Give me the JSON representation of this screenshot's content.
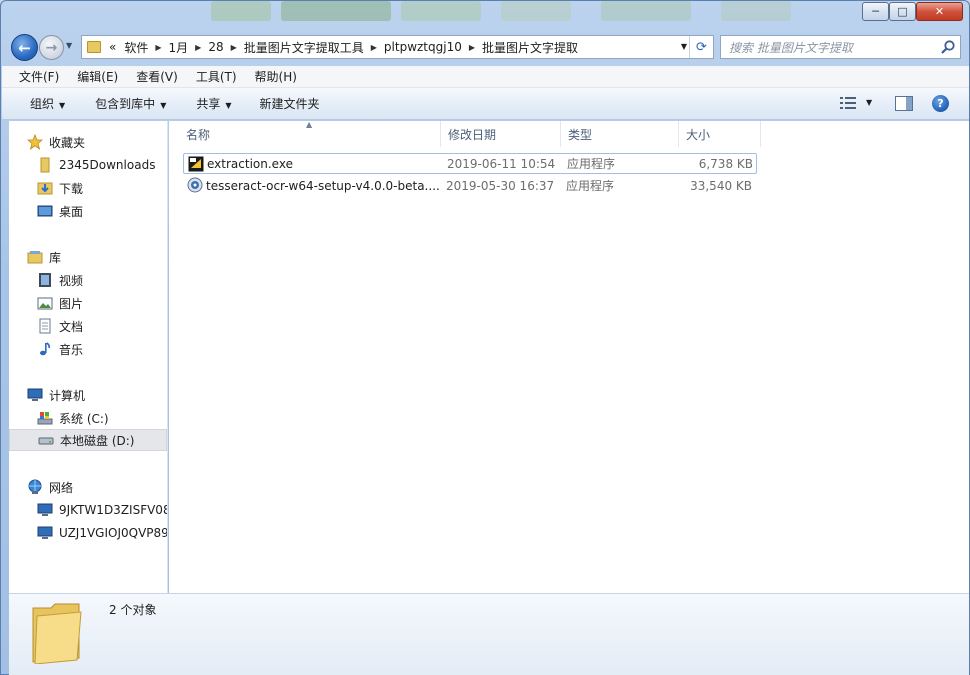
{
  "window": {
    "controls": {
      "minimize": "─",
      "maximize": "□",
      "close": "✕"
    }
  },
  "nav": {
    "back_glyph": "←",
    "forward_glyph": "→",
    "overflow": "«",
    "breadcrumbs": [
      "软件",
      "1月",
      "28",
      "批量图片文字提取工具",
      "pltpwztqgj10",
      "批量图片文字提取"
    ],
    "refresh_glyph": "⟳",
    "search_placeholder": "搜索 批量图片文字提取"
  },
  "menubar": [
    "文件(F)",
    "编辑(E)",
    "查看(V)",
    "工具(T)",
    "帮助(H)"
  ],
  "toolbar": {
    "organize": "组织",
    "include_in_library": "包含到库中",
    "share": "共享",
    "new_folder": "新建文件夹",
    "help": "?"
  },
  "sidebar": {
    "favorites": {
      "label": "收藏夹",
      "items": [
        "2345Downloads",
        "下载",
        "桌面"
      ]
    },
    "libraries": {
      "label": "库",
      "items": [
        "视频",
        "图片",
        "文档",
        "音乐"
      ]
    },
    "computer": {
      "label": "计算机",
      "items": [
        "系统 (C:)",
        "本地磁盘 (D:)"
      ],
      "selected": "本地磁盘 (D:)"
    },
    "network": {
      "label": "网络",
      "items": [
        "9JKTW1D3ZISFV08",
        "UZJ1VGIOJ0QVP89"
      ]
    }
  },
  "columns": {
    "name": "名称",
    "date": "修改日期",
    "type": "类型",
    "size": "大小"
  },
  "files": [
    {
      "name": "extraction.exe",
      "date": "2019-06-11 10:54",
      "type": "应用程序",
      "size": "6,738 KB",
      "icon": "exe-icon"
    },
    {
      "name": "tesseract-ocr-w64-setup-v4.0.0-beta....",
      "date": "2019-05-30 16:37",
      "type": "应用程序",
      "size": "33,540 KB",
      "icon": "installer-icon"
    }
  ],
  "status": {
    "count": "2 个对象"
  },
  "colors": {
    "accent": "#2b6ac2",
    "folder": "#e8c860",
    "selection": "#e4e6ea",
    "focus_border": "#9fbfe4"
  }
}
